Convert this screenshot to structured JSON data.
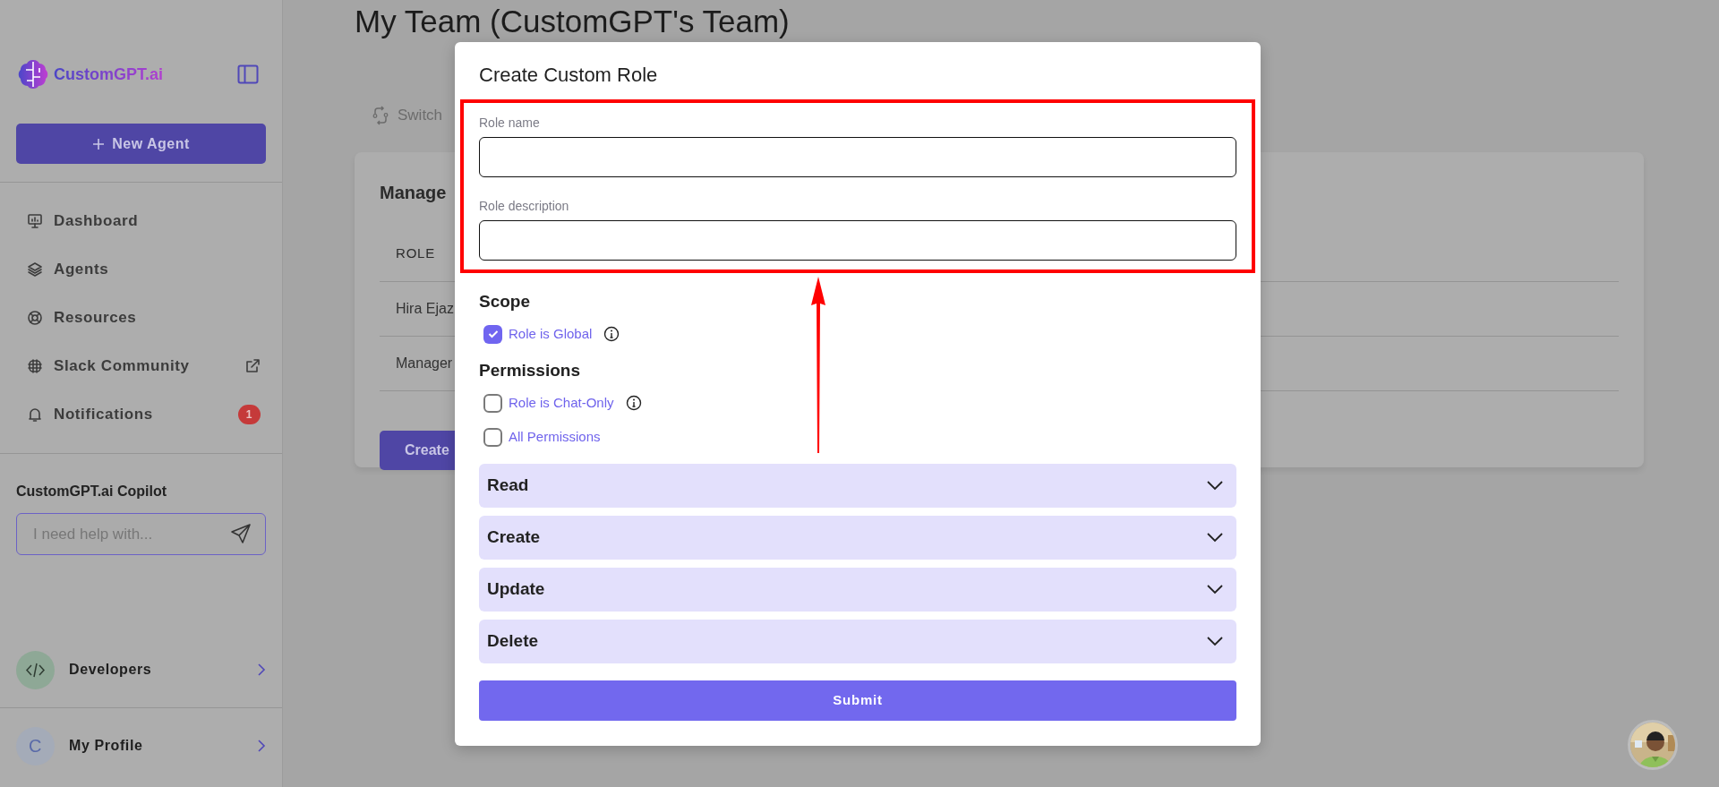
{
  "sidebar": {
    "logo": "CustomGPT.ai",
    "new_agent_button": "New Agent",
    "nav_items": [
      {
        "label": "Dashboard"
      },
      {
        "label": "Agents"
      },
      {
        "label": "Resources"
      },
      {
        "label": "Slack Community",
        "external": true
      },
      {
        "label": "Notifications",
        "badge": "1"
      }
    ],
    "copilot": {
      "title": "CustomGPT.ai Copilot",
      "placeholder": "I need help with..."
    },
    "footer_items": [
      {
        "label": "Developers",
        "kind": "code"
      },
      {
        "label": "My Profile",
        "kind": "avatar",
        "avatar_letter": "C"
      }
    ]
  },
  "main": {
    "title": "My Team (CustomGPT's Team)",
    "switch_link": "Switch",
    "card": {
      "title": "Manage",
      "columns": [
        "ROLE"
      ],
      "rows": [
        "Hira Ejaz",
        "Manager"
      ],
      "button": "Create"
    }
  },
  "modal": {
    "title": "Create Custom Role",
    "fields": [
      {
        "label": "Role name"
      },
      {
        "label": "Role description"
      }
    ],
    "scope": {
      "title": "Scope",
      "options": [
        {
          "label": "Role is Global",
          "checked": true,
          "info": true
        }
      ]
    },
    "permissions": {
      "title": "Permissions",
      "options": [
        {
          "label": "Role is Chat-Only",
          "checked": false,
          "info": true
        },
        {
          "label": "All Permissions",
          "checked": false,
          "info": false
        }
      ]
    },
    "sections": [
      {
        "label": "Read",
        "expanded": false
      },
      {
        "label": "Create",
        "expanded": false
      },
      {
        "label": "Update",
        "expanded": false
      },
      {
        "label": "Delete",
        "expanded": false
      }
    ],
    "submit": "Submit"
  }
}
